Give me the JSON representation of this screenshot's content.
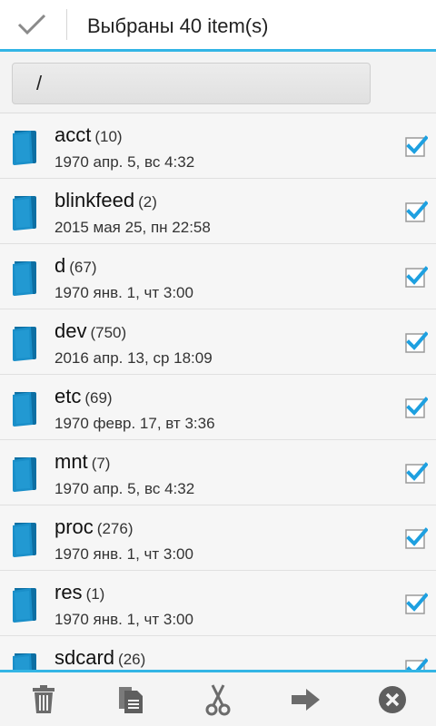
{
  "action_bar": {
    "title": "Выбраны 40 item(s)",
    "done_icon": "checkmark-icon"
  },
  "path": {
    "value": "/"
  },
  "files": [
    {
      "name": "acct",
      "count": "(10)",
      "date": "1970 апр. 5, вс 4:32",
      "checked": true
    },
    {
      "name": "blinkfeed",
      "count": "(2)",
      "date": "2015 мая 25, пн 22:58",
      "checked": true
    },
    {
      "name": "d",
      "count": "(67)",
      "date": "1970 янв. 1, чт 3:00",
      "checked": true
    },
    {
      "name": "dev",
      "count": "(750)",
      "date": "2016 апр. 13, ср 18:09",
      "checked": true
    },
    {
      "name": "etc",
      "count": "(69)",
      "date": "1970 февр. 17, вт 3:36",
      "checked": true
    },
    {
      "name": "mnt",
      "count": "(7)",
      "date": "1970 апр. 5, вс 4:32",
      "checked": true
    },
    {
      "name": "proc",
      "count": "(276)",
      "date": "1970 янв. 1, чт 3:00",
      "checked": true
    },
    {
      "name": "res",
      "count": "(1)",
      "date": "1970 янв. 1, чт 3:00",
      "checked": true
    },
    {
      "name": "sdcard",
      "count": "(26)",
      "date": "",
      "checked": true
    }
  ],
  "bottom_bar": {
    "actions": [
      "delete-icon",
      "copy-icon",
      "cut-icon",
      "move-icon",
      "cancel-icon"
    ]
  },
  "colors": {
    "accent": "#33b5e5",
    "folder": "#1a8fc9",
    "check": "#1ea0e0"
  }
}
